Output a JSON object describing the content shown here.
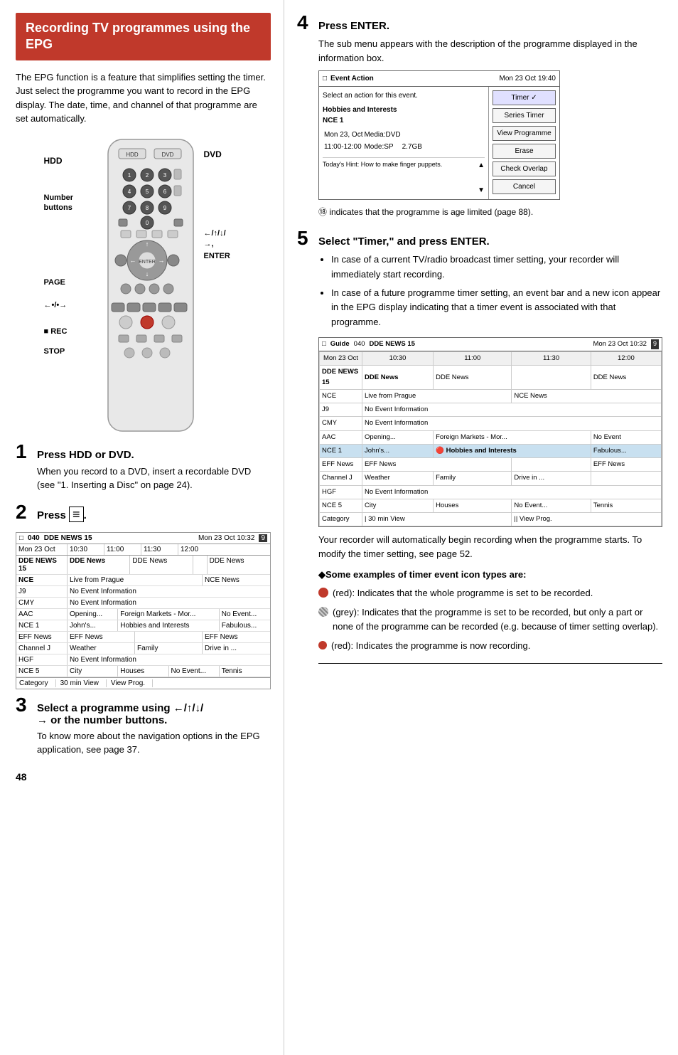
{
  "left": {
    "title": "Recording TV programmes using the EPG",
    "intro": "The EPG function is a feature that simplifies setting the timer. Just select the programme you want to record in the EPG display. The date, time, and channel of that programme are set automatically.",
    "labels": {
      "hdd": "HDD",
      "dvd": "DVD",
      "number_buttons": "Number\nbuttons",
      "page": "PAGE",
      "rec": "■ REC",
      "stop": "STOP",
      "enter": "ENTER"
    },
    "steps": [
      {
        "num": "1",
        "title": "Press HDD or DVD.",
        "body": "When you record to a DVD, insert a recordable DVD (see \"1. Inserting a Disc\" on page 24)."
      },
      {
        "num": "2",
        "title": "Press",
        "title_suffix": ".",
        "body": ""
      },
      {
        "num": "3",
        "title": "Select a programme using ←/↑/↓/→ or the number buttons.",
        "body": "To know more about the navigation options in the EPG application, see page 37."
      }
    ],
    "guide_small": {
      "icon": "□",
      "ch_num": "040",
      "ch_name": "DDE NEWS 15",
      "date": "Mon 23 Oct   10:32",
      "bookmark": "9",
      "times": [
        "Mon 23 Oct",
        "10:30",
        "11:00",
        "11:30",
        "12:00"
      ],
      "rows": [
        {
          "ch": "DDE NEWS 15",
          "cols": [
            "DDE News",
            "DDE News",
            "",
            "DDE News"
          ]
        },
        {
          "ch": "NCE",
          "cols": [
            "Live from Prague",
            "",
            "NCE News",
            ""
          ]
        },
        {
          "ch": "J9",
          "cols": [
            "No Event Information"
          ]
        },
        {
          "ch": "CMY",
          "cols": [
            "No Event Information"
          ]
        },
        {
          "ch": "AAC",
          "cols": [
            "Opening...",
            "Foreign Markets - Mor...",
            "No Event..."
          ]
        },
        {
          "ch": "NCE 1",
          "cols": [
            "John's...",
            "Hobbies and Interests",
            "Fabulous..."
          ]
        },
        {
          "ch": "EFF News",
          "cols": [
            "EFF News",
            "",
            "EFF News"
          ]
        },
        {
          "ch": "Channel J",
          "cols": [
            "Weather",
            "Family",
            "Drive in ..."
          ]
        },
        {
          "ch": "HGF",
          "cols": [
            "No Event Information"
          ]
        },
        {
          "ch": "NCE 5",
          "cols": [
            "City",
            "Houses",
            "No Event...",
            "Tennis"
          ]
        }
      ],
      "footer": [
        "Category",
        "30 min View",
        "View Prog."
      ]
    },
    "page_num": "48"
  },
  "right": {
    "steps": [
      {
        "num": "4",
        "title": "Press ENTER.",
        "body": "The sub menu appears with the description of the programme displayed in the information box.",
        "event_action": {
          "icon": "□",
          "title": "Event Action",
          "date": "Mon 23 Oct  19:40",
          "subtitle": "Select an action for this event.",
          "prog_title": "Hobbies and Interests\nNCE 1",
          "prog_date": "Mon 23 Oct",
          "media_label": "Media:",
          "media_val": "DVD",
          "mode_label": "Mode:SP",
          "mode_size": "2.7GB",
          "hint": "Today's Hint: How to make finger puppets.",
          "buttons": [
            "Timer",
            "Series Timer",
            "View Programme",
            "Erase",
            "Check Overlap",
            "Cancel"
          ],
          "scroll_up": "▲",
          "scroll_down": "▼"
        },
        "note": "⑱ indicates that the programme is age limited (page 88)."
      },
      {
        "num": "5",
        "title": "Select \"Timer,\" and press ENTER.",
        "bullets": [
          "In case of a current TV/radio broadcast timer setting, your recorder will immediately start recording.",
          "In case of a future programme timer setting, an event bar and a new icon appear in the EPG display indicating that a timer event is associated with that programme."
        ],
        "guide_big": {
          "icon": "□",
          "title": "Guide",
          "ch_num": "040",
          "ch_name": "DDE NEWS 15",
          "date": "Mon 23 Oct  10:32",
          "bookmark": "9",
          "times": [
            "Mon 23 Oct",
            "10:30",
            "11:00",
            "11:30",
            "12:00"
          ],
          "rows": [
            {
              "ch": "DDE NEWS 15",
              "c1": "DDE News",
              "c2": "DDE News",
              "c3": "",
              "c4": "DDE News",
              "highlight": false
            },
            {
              "ch": "NCE",
              "c1": "Live from Prague",
              "c2": "",
              "c3": "NCE News",
              "c4": "",
              "highlight": false
            },
            {
              "ch": "J9",
              "c1": "No Event Information",
              "c2": "",
              "c3": "",
              "c4": "",
              "highlight": false
            },
            {
              "ch": "CMY",
              "c1": "No Event Information",
              "c2": "",
              "c3": "",
              "c4": "",
              "highlight": false
            },
            {
              "ch": "AAC",
              "c1": "Opening...",
              "c2": "Foreign Markets - Mor...",
              "c3": "",
              "c4": "No Event...",
              "highlight": false
            },
            {
              "ch": "NCE 1",
              "c1": "John's...",
              "c2": "🔴Hobbies and Interests",
              "c3": "",
              "c4": "Fabulous...",
              "highlight": true
            },
            {
              "ch": "EFF News",
              "c1": "EFF News",
              "c2": "",
              "c3": "",
              "c4": "EFF News",
              "highlight": false
            },
            {
              "ch": "Channel J",
              "c1": "Weather",
              "c2": "Family",
              "c3": "Drive in ...",
              "c4": "",
              "highlight": false
            },
            {
              "ch": "HGF",
              "c1": "No Event Information",
              "c2": "",
              "c3": "",
              "c4": "",
              "highlight": false
            },
            {
              "ch": "NCE 5",
              "c1": "City",
              "c2": "Houses",
              "c3": "No Event...",
              "c4": "Tennis",
              "highlight": false
            }
          ],
          "footer": [
            "Category",
            "30 min View",
            "View Prog."
          ]
        },
        "after_text": "Your recorder will automatically begin recording when the programme starts. To modify the timer setting, see page 52."
      }
    ],
    "icon_section_title": "◆Some examples of timer event icon types are:",
    "icon_legends": [
      {
        "color": "red",
        "label": "(red): Indicates that the whole programme is set to be recorded."
      },
      {
        "color": "grey",
        "label": "(grey): Indicates that the programme is set to be recorded, but only a part or none of the programme can be recorded (e.g. because of timer setting overlap)."
      },
      {
        "color": "red",
        "label": "(red): Indicates the programme is now recording."
      }
    ]
  }
}
